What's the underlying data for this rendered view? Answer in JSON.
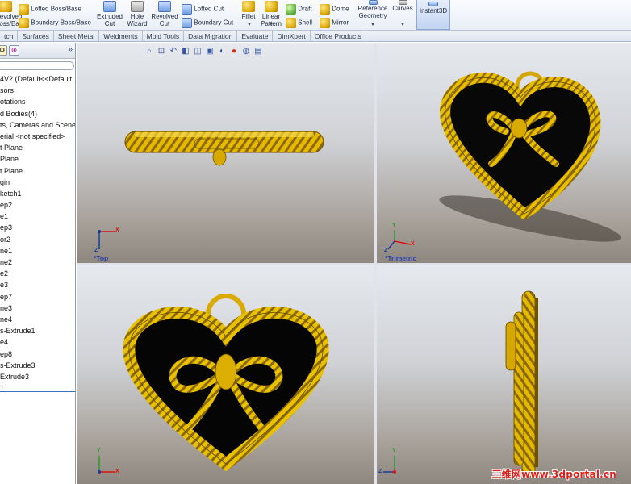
{
  "ribbon": {
    "revolved_boss": "Revolved\nBoss/Base",
    "lofted_boss": "Lofted Boss/Base",
    "boundary_boss": "Boundary Boss/Base",
    "extruded_cut": "Extruded\nCut",
    "hole_wizard": "Hole\nWizard",
    "revolved_cut": "Revolved\nCut",
    "lofted_cut": "Lofted Cut",
    "boundary_cut": "Boundary Cut",
    "fillet": "Fillet",
    "linear_pattern": "Linear\nPattern",
    "draft": "Draft",
    "shell": "Shell",
    "dome": "Dome",
    "mirror": "Mirror",
    "reference_geometry": "Reference\nGeometry",
    "curves": "Curves",
    "instant3d": "Instant3D"
  },
  "tabs": [
    "tch",
    "Surfaces",
    "Sheet Metal",
    "Weldments",
    "Mold Tools",
    "Data Migration",
    "Evaluate",
    "DimXpert",
    "Office Products"
  ],
  "tree": {
    "expand_label": "»",
    "items": [
      "4V2  (Default<<Default",
      "sors",
      "otations",
      "d Bodies(4)",
      "ts, Cameras and Scene",
      "erial <not specified>",
      "t Plane",
      " Plane",
      "t Plane",
      "gin",
      "ketch1",
      "ep2",
      "e1",
      "ep3",
      "or2",
      "ne1",
      "ne2",
      "e2",
      "e3",
      "ep7",
      "ne3",
      "ne4",
      "s-Extrude1",
      "e4",
      "ep8",
      "s-Extrude3",
      "Extrude3",
      "1"
    ]
  },
  "viewports": {
    "top_label": "*Top",
    "trimetric_label": "*Trimetric",
    "front_label": "",
    "right_label": ""
  },
  "axes": {
    "x": "X",
    "y": "Y",
    "z": "Z"
  },
  "watermark": "三维网www.3dportal.cn",
  "colors": {
    "gold": "#e2b400",
    "gold_dark": "#8a6a00",
    "enamel": "#0a0a0a",
    "viewport_label": "#2b3fa8",
    "ribbon_active": "#c3d4f1"
  },
  "view_toolbar_icons": [
    "zoom-fit-icon",
    "zoom-area-icon",
    "previous-view-icon",
    "section-view-icon",
    "view-orientation-icon",
    "display-style-icon",
    "hide-show-icon",
    "edit-appearance-icon",
    "apply-scene-icon",
    "view-settings-icon"
  ]
}
